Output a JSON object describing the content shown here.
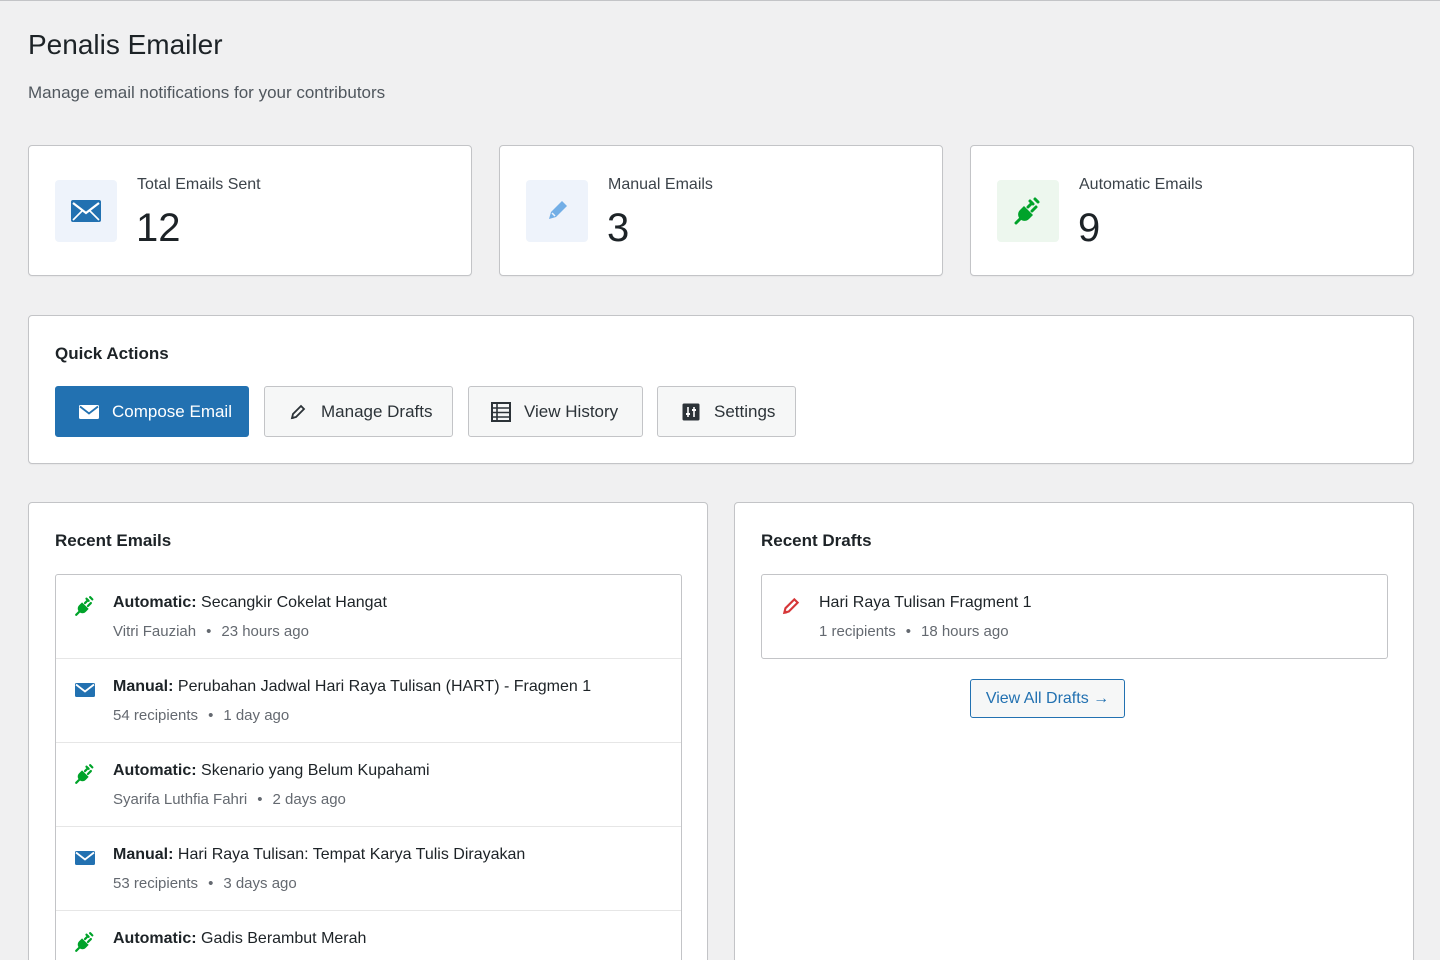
{
  "header": {
    "title": "Penalis Emailer",
    "subtitle": "Manage email notifications for your contributors"
  },
  "stats": [
    {
      "label": "Total Emails Sent",
      "value": "12",
      "icon": "envelope-icon",
      "color": "#2271b1",
      "bg": "#eef3fb"
    },
    {
      "label": "Manual Emails",
      "value": "3",
      "icon": "pencil-icon",
      "color": "#72aee6",
      "bg": "#eef3fb"
    },
    {
      "label": "Automatic Emails",
      "value": "9",
      "icon": "plug-icon",
      "color": "#00a32a",
      "bg": "#edf7ee"
    }
  ],
  "quick_actions": {
    "title": "Quick Actions",
    "buttons": [
      {
        "label": "Compose Email",
        "icon": "envelope-icon",
        "style": "primary"
      },
      {
        "label": "Manage Drafts",
        "icon": "pencil-icon",
        "style": "secondary"
      },
      {
        "label": "View History",
        "icon": "list-icon",
        "style": "secondary"
      },
      {
        "label": "Settings",
        "icon": "sliders-icon",
        "style": "secondary"
      }
    ]
  },
  "recent_emails": {
    "title": "Recent Emails",
    "items": [
      {
        "type": "Automatic:",
        "subject": "Secangkir Cokelat Hangat",
        "meta1": "Vitri Fauziah",
        "meta2": "23 hours ago",
        "icon": "plug-icon"
      },
      {
        "type": "Manual:",
        "subject": "Perubahan Jadwal Hari Raya Tulisan (HART) - Fragmen 1",
        "meta1": "54 recipients",
        "meta2": "1 day ago",
        "icon": "envelope-icon"
      },
      {
        "type": "Automatic:",
        "subject": "Skenario yang Belum Kupahami",
        "meta1": "Syarifa Luthfia Fahri",
        "meta2": "2 days ago",
        "icon": "plug-icon"
      },
      {
        "type": "Manual:",
        "subject": "Hari Raya Tulisan: Tempat Karya Tulis Dirayakan",
        "meta1": "53 recipients",
        "meta2": "3 days ago",
        "icon": "envelope-icon"
      },
      {
        "type": "Automatic:",
        "subject": "Gadis Berambut Merah",
        "meta1": "",
        "meta2": "",
        "icon": "plug-icon"
      }
    ]
  },
  "recent_drafts": {
    "title": "Recent Drafts",
    "items": [
      {
        "title": "Hari Raya Tulisan Fragment 1",
        "meta1": "1 recipients",
        "meta2": "18 hours ago",
        "icon": "pencil-icon"
      }
    ],
    "view_all_label": "View All Drafts →"
  },
  "meta_separator": "•"
}
